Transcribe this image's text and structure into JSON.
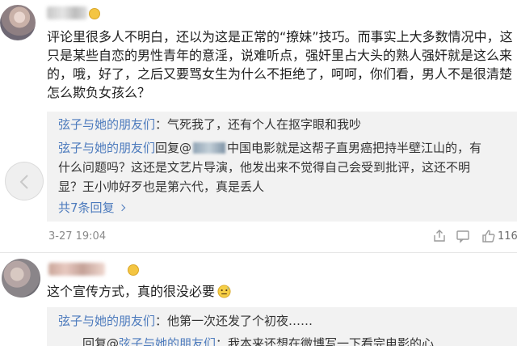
{
  "comment1": {
    "text": "评论里很多人不明白，还以为这是正常的“撩妹”技巧。而事实上大多数情况中，这只是某些自恋的男性青年的意淫，说难听点，强奸里占大头的熟人强奸就是这么来的，哦，好了，之后又要骂女生为什么不拒绝了，呵呵，你们看，男人不是很清楚怎么欺负女孩么？",
    "replies": [
      {
        "author": "弦子与她的朋友们",
        "sep": "：",
        "text": "气死我了，还有个人在抠字眼和我吵"
      },
      {
        "author": "弦子与她的朋友们",
        "reply_word": "回复@",
        "line1": "中国电影就是这帮子直男癌把持半壁江山的，有",
        "line2": "什么问题吗？这还是文艺片导演，他发出来不觉得自己会受到批评，这还不明",
        "line3": "显？王小帅好歹也是第六代，真是丢人"
      }
    ],
    "more_replies": "共7条回复",
    "time": "3-27 19:04",
    "like_count": "116"
  },
  "comment2": {
    "text": "这个宣传方式，真的很没必要",
    "replies": [
      {
        "author": "弦子与她的朋友们",
        "sep": "：",
        "text": "他第一次还发了个初夜……"
      },
      {
        "prefix": "……回复@",
        "author": "弦子与她的朋友们",
        "text": "：我本来还想在微博写一下看完电影的心"
      }
    ]
  },
  "colors": {
    "link": "#4d7bbd",
    "reply_bg": "#f2f2f2",
    "meta": "#8a8a8a"
  }
}
